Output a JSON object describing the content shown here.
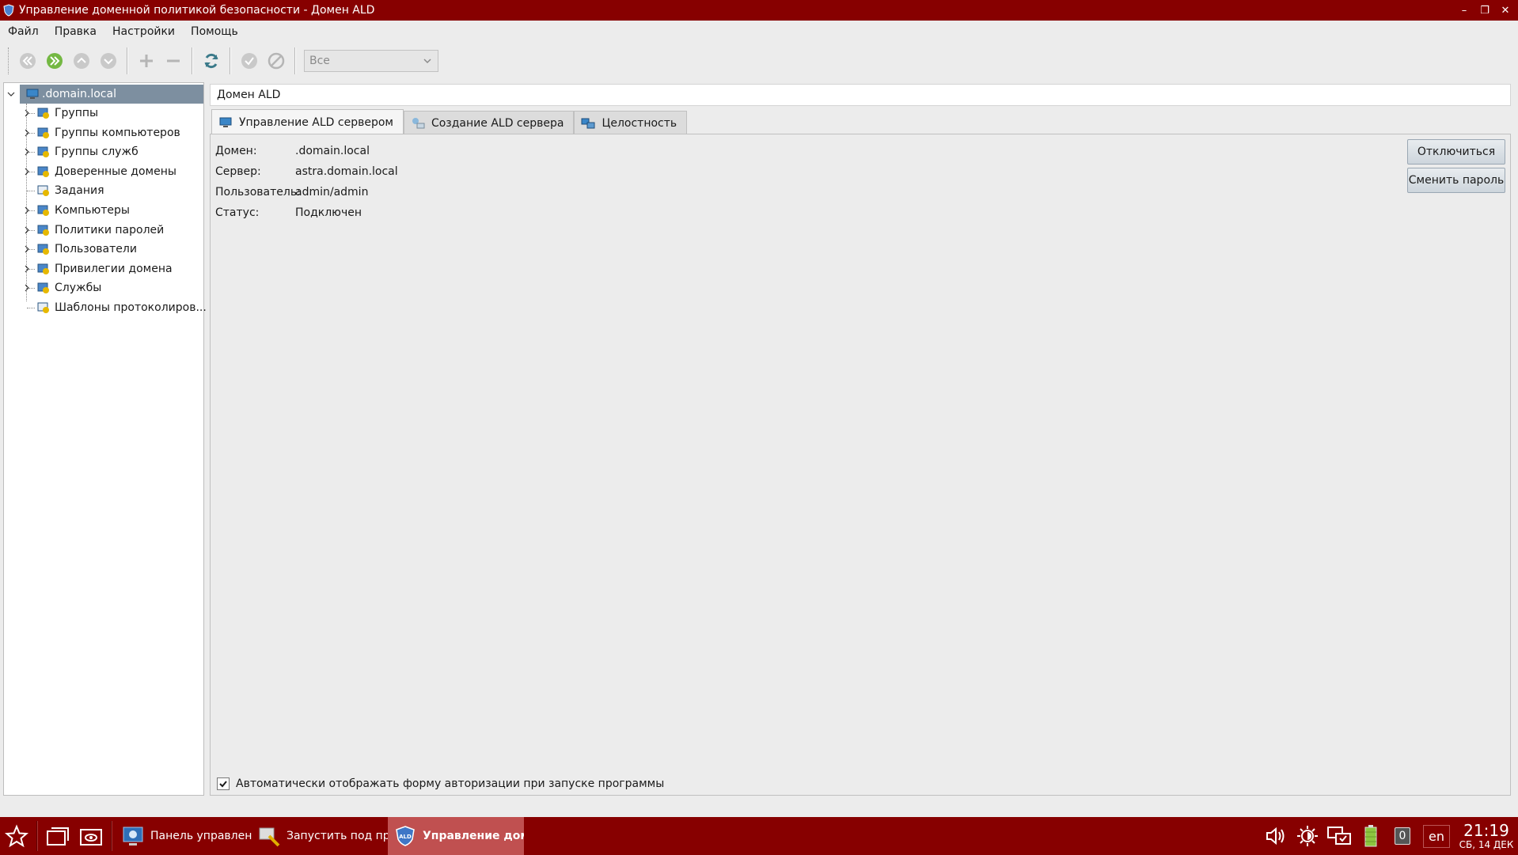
{
  "window": {
    "title": "Управление доменной политикой безопасности - Домен ALD",
    "brand_color": "#870000"
  },
  "menu": [
    "Файл",
    "Правка",
    "Настройки",
    "Помощь"
  ],
  "toolbar": {
    "filter_value": "Все",
    "buttons": [
      "back-icon",
      "forward-icon",
      "up-icon",
      "down-icon",
      "add-icon",
      "remove-icon",
      "refresh-icon",
      "apply-icon",
      "cancel-icon"
    ]
  },
  "tree": {
    "root": ".domain.local",
    "items": [
      {
        "label": "Группы",
        "expandable": true
      },
      {
        "label": "Группы компьютеров",
        "expandable": true
      },
      {
        "label": "Группы служб",
        "expandable": true
      },
      {
        "label": "Доверенные домены",
        "expandable": true
      },
      {
        "label": "Задания",
        "expandable": false
      },
      {
        "label": "Компьютеры",
        "expandable": true
      },
      {
        "label": "Политики паролей",
        "expandable": true
      },
      {
        "label": "Пользователи",
        "expandable": true
      },
      {
        "label": "Привилегии домена",
        "expandable": true
      },
      {
        "label": "Службы",
        "expandable": true
      },
      {
        "label": "Шаблоны протоколиров...",
        "expandable": false
      }
    ]
  },
  "main": {
    "header": "Домен ALD",
    "tabs": [
      "Управление ALD сервером",
      "Создание ALD сервера",
      "Целостность"
    ],
    "info": [
      {
        "key": "Домен:",
        "value": ".domain.local"
      },
      {
        "key": "Сервер:",
        "value": "astra.domain.local"
      },
      {
        "key": "Пользователь:",
        "value": "admin/admin"
      },
      {
        "key": "Статус:",
        "value": "Подключен"
      }
    ],
    "disconnect_label": "Отключиться",
    "change_password_label": "Сменить пароль",
    "auto_auth_label": "Автоматически отображать форму авторизации при запуске программы",
    "auto_auth_checked": true
  },
  "taskbar": {
    "tasks": [
      {
        "label": "Панель управлен...",
        "active": false
      },
      {
        "label": "Запустить под пр...",
        "active": false
      },
      {
        "label": "Управление дом...",
        "active": true
      }
    ],
    "notification_count": "0",
    "lang": "en",
    "time": "21:19",
    "date": "СБ, 14 ДЕК"
  }
}
